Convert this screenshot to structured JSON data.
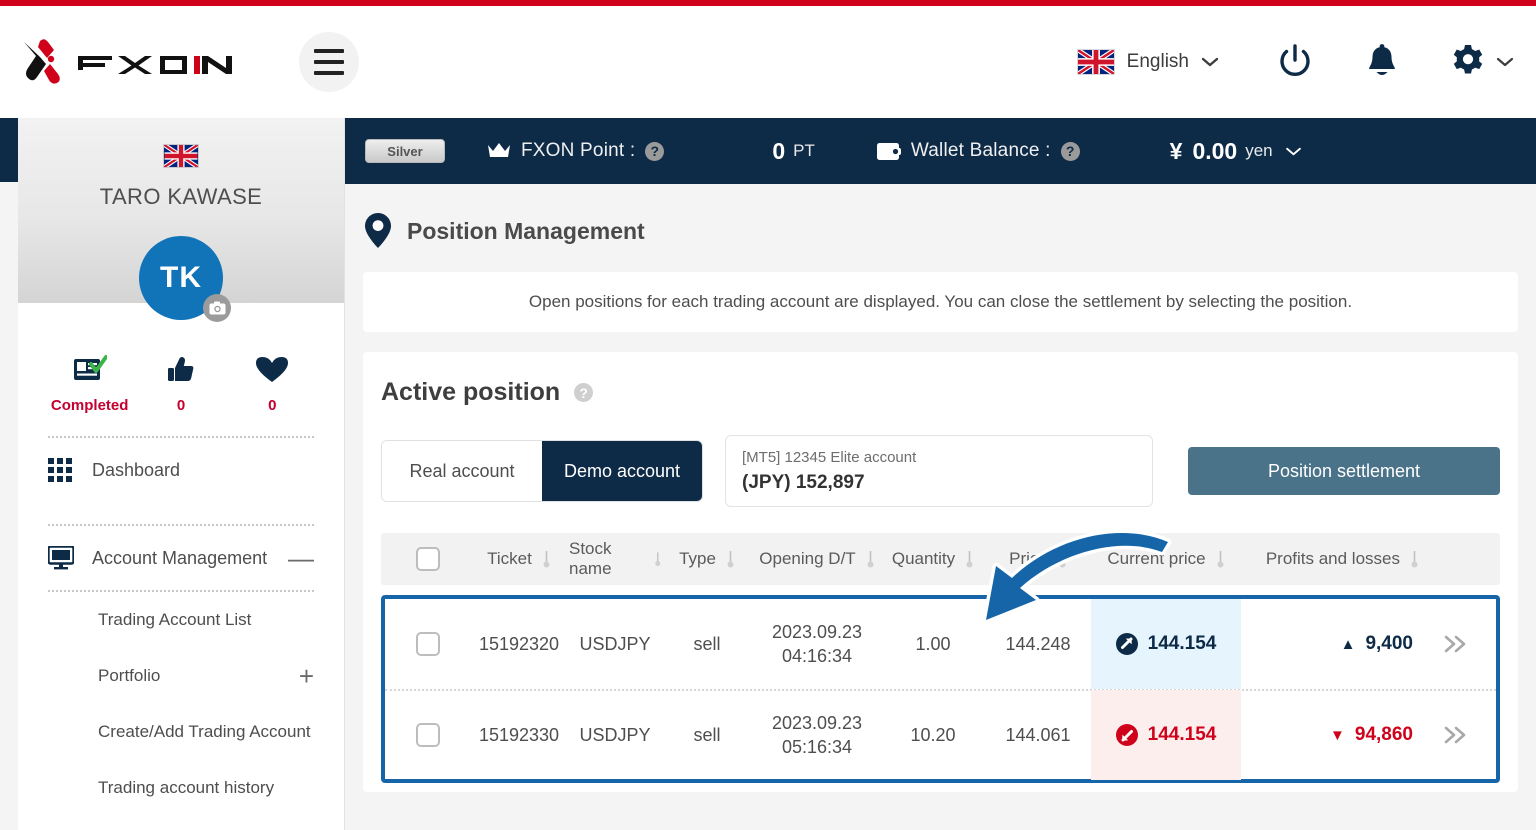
{
  "header": {
    "brand": "FXON",
    "menu_icon": "hamburger-icon",
    "language": {
      "label": "English",
      "flag": "uk-flag",
      "chevron": "⌄"
    },
    "icons": [
      "power-icon",
      "bell-icon",
      "gear-icon"
    ],
    "gear_chevron": "⌄"
  },
  "sidebar": {
    "flag": "uk-flag",
    "user_name": "TARO KAWASE",
    "avatar_initials": "TK",
    "avatar_color": "#1173b8",
    "camera_badge": "camera-icon",
    "stats": [
      {
        "icon": "id-card-check-icon",
        "label": "Completed"
      },
      {
        "icon": "thumbs-up-icon",
        "label": "0"
      },
      {
        "icon": "heart-icon",
        "label": "0"
      }
    ],
    "nav": [
      {
        "icon": "grid-icon",
        "label": "Dashboard",
        "toggle": ""
      },
      {
        "icon": "monitor-icon",
        "label": "Account Management",
        "toggle": "—"
      }
    ],
    "sub_items": [
      {
        "label": "Trading Account List",
        "toggle": ""
      },
      {
        "label": "Portfolio",
        "toggle": "+"
      },
      {
        "label": "Create/Add Trading Account",
        "toggle": ""
      },
      {
        "label": "Trading account history",
        "toggle": ""
      }
    ]
  },
  "infobar": {
    "rank_badge": "Silver",
    "point_icon": "crown-icon",
    "point_label": "FXON Point :",
    "point_help": "?",
    "point_value": "0",
    "point_unit": "PT",
    "wallet_icon": "wallet-icon",
    "wallet_label": "Wallet Balance :",
    "wallet_help": "?",
    "wallet_symbol": "¥",
    "wallet_value": "0.00",
    "wallet_unit": "yen",
    "wallet_chevron": "⌄"
  },
  "page": {
    "pin_icon": "location-pin-icon",
    "title": "Position Management",
    "description": "Open positions for each trading account are displayed. You can close the settlement by selecting the position."
  },
  "panel": {
    "title": "Active position",
    "help": "?",
    "account_tabs": [
      {
        "label": "Real account",
        "active": false
      },
      {
        "label": "Demo account",
        "active": true
      }
    ],
    "account_selector": {
      "sub": "[MT5] 12345 Elite account",
      "main": "(JPY) 152,897"
    },
    "settlement_button": "Position settlement"
  },
  "table": {
    "columns": [
      {
        "key": "checkbox",
        "label": "",
        "sortable": false
      },
      {
        "key": "ticket",
        "label": "Ticket",
        "sortable": true
      },
      {
        "key": "stock",
        "label": "Stock name",
        "sortable": true
      },
      {
        "key": "type",
        "label": "Type",
        "sortable": true
      },
      {
        "key": "opening",
        "label": "Opening D/T",
        "sortable": true
      },
      {
        "key": "quantity",
        "label": "Quantity",
        "sortable": true
      },
      {
        "key": "price",
        "label": "Price",
        "sortable": true
      },
      {
        "key": "current",
        "label": "Current price",
        "sortable": true
      },
      {
        "key": "pl",
        "label": "Profits and losses",
        "sortable": true
      },
      {
        "key": "more",
        "label": "",
        "sortable": false
      }
    ],
    "rows": [
      {
        "ticket": "15192320",
        "stock": "USDJPY",
        "type": "sell",
        "opening_date": "2023.09.23",
        "opening_time": "04:16:34",
        "quantity": "1.00",
        "price": "144.248",
        "current": "144.154",
        "current_direction": "up",
        "current_icon": "arrow-up-right-circle-icon",
        "pl": "9,400",
        "pl_direction": "up",
        "pl_marker": "▲",
        "more_icon": "chevron-double-right-icon"
      },
      {
        "ticket": "15192330",
        "stock": "USDJPY",
        "type": "sell",
        "opening_date": "2023.09.23",
        "opening_time": "05:16:34",
        "quantity": "10.20",
        "price": "144.061",
        "current": "144.154",
        "current_direction": "down",
        "current_icon": "arrow-down-left-circle-icon",
        "pl": "94,860",
        "pl_direction": "down",
        "pl_marker": "▼",
        "more_icon": "chevron-double-right-icon"
      }
    ]
  },
  "annotation": {
    "arrow_icon": "curved-arrow-annotation",
    "arrow_color": "#1565a8",
    "highlight_color": "#1565a8"
  },
  "colors": {
    "brand_red": "#d0021b",
    "navy": "#0d2a47",
    "accent_blue": "#1565a8",
    "up_bg": "#e5f4fd",
    "down_bg": "#fdeeee",
    "settle_btn": "#4a7289"
  }
}
